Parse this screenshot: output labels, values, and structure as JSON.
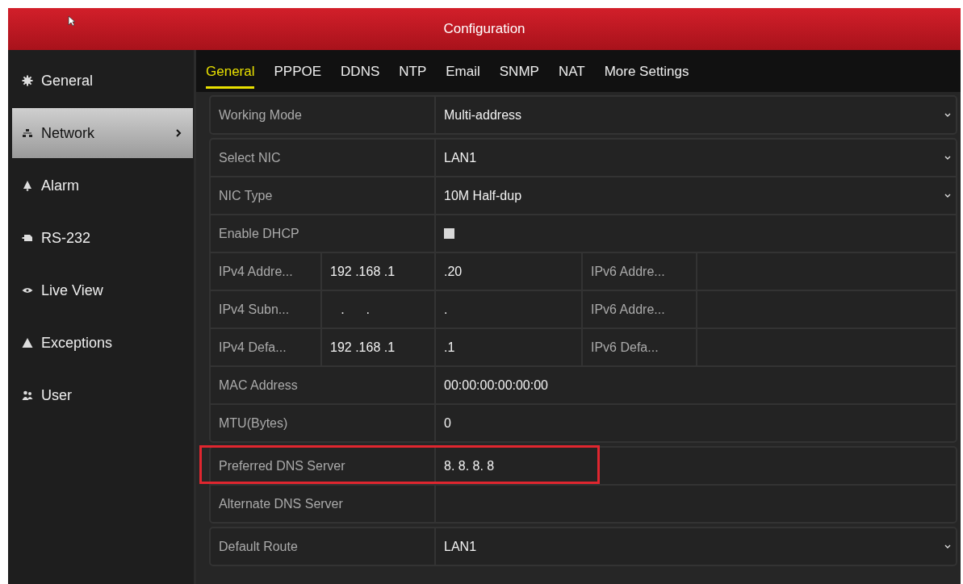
{
  "window": {
    "title": "Configuration"
  },
  "sidebar": {
    "items": [
      {
        "label": "General",
        "selected": false
      },
      {
        "label": "Network",
        "selected": true
      },
      {
        "label": "Alarm",
        "selected": false
      },
      {
        "label": "RS-232",
        "selected": false
      },
      {
        "label": "Live View",
        "selected": false
      },
      {
        "label": "Exceptions",
        "selected": false
      },
      {
        "label": "User",
        "selected": false
      }
    ]
  },
  "tabs": [
    {
      "label": "General",
      "selected": true
    },
    {
      "label": "PPPOE",
      "selected": false
    },
    {
      "label": "DDNS",
      "selected": false
    },
    {
      "label": "NTP",
      "selected": false
    },
    {
      "label": "Email",
      "selected": false
    },
    {
      "label": "SNMP",
      "selected": false
    },
    {
      "label": "NAT",
      "selected": false
    },
    {
      "label": "More Settings",
      "selected": false
    }
  ],
  "groups": [
    {
      "rows": [
        {
          "kind": "dropdown",
          "label": "Working Mode",
          "value": "Multi-address",
          "highlighted": false
        }
      ]
    },
    {
      "rows": [
        {
          "kind": "dropdown",
          "label": "Select NIC",
          "value": "LAN1",
          "highlighted": false
        },
        {
          "kind": "dropdown",
          "label": "NIC Type",
          "value": "10M Half-dup",
          "highlighted": false
        },
        {
          "kind": "checkbox",
          "label": "Enable DHCP",
          "checked": false,
          "highlighted": false
        },
        {
          "kind": "split",
          "label": "IPv4 Addre...",
          "parts": [
            "192 .168 .1",
            ".20"
          ],
          "label_2": "IPv6 Addre...",
          "highlighted": false
        },
        {
          "kind": "split",
          "label": "IPv4 Subn...",
          "parts": [
            "   .      .",
            "."
          ],
          "label_2": "IPv6 Addre...",
          "highlighted": false
        },
        {
          "kind": "split",
          "label": "IPv4 Defa...",
          "parts": [
            "192 .168 .1",
            ".1"
          ],
          "label_2": "IPv6 Defa...",
          "highlighted": false
        },
        {
          "kind": "text",
          "label": "MAC Address",
          "value": "00:00:00:00:00:00",
          "highlighted": false
        },
        {
          "kind": "text",
          "label": "MTU(Bytes)",
          "value": "0",
          "highlighted": false
        }
      ]
    },
    {
      "rows": [
        {
          "kind": "text",
          "label": "Preferred DNS Server",
          "value": "8. 8. 8. 8",
          "highlighted": true
        },
        {
          "kind": "text",
          "label": "Alternate DNS Server",
          "highlighted": false
        }
      ]
    },
    {
      "rows": [
        {
          "kind": "dropdown",
          "label": "Default Route",
          "value": "LAN1",
          "highlighted": false
        }
      ]
    }
  ]
}
